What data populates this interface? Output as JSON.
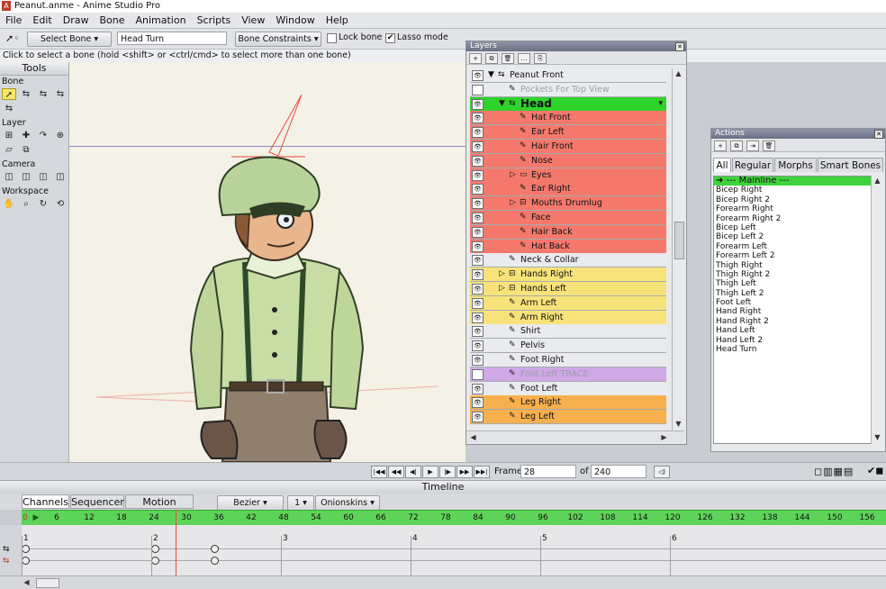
{
  "window": {
    "title": "Peanut.anme - Anime Studio Pro",
    "app_icon": "A"
  },
  "menu": [
    "File",
    "Edit",
    "Draw",
    "Bone",
    "Animation",
    "Scripts",
    "View",
    "Window",
    "Help"
  ],
  "toolbar": {
    "mode_select": "Select Bone",
    "bone_name": "Head Turn",
    "constraints_button": "Bone Constraints",
    "lock_bone_label": "Lock bone",
    "lock_bone_checked": false,
    "lasso_label": "Lasso mode",
    "lasso_checked": true
  },
  "hint": "Click to select a bone (hold <shift> or <ctrl/cmd> to select more than one bone)",
  "tools": {
    "title": "Tools",
    "sections": [
      "Bone",
      "Layer",
      "Camera",
      "Workspace"
    ]
  },
  "layers": {
    "title": "Layers",
    "rows": [
      {
        "name": "Peanut Front",
        "color": "#e9ebee",
        "indent": 0,
        "arrow": "▼",
        "kind": "bone",
        "hidden": false
      },
      {
        "name": "Pockets For Top View",
        "color": "#e9ebee",
        "indent": 1,
        "arrow": "",
        "kind": "vector",
        "hidden": true
      },
      {
        "name": "Head",
        "color": "#2fd32b",
        "indent": 1,
        "arrow": "▼",
        "kind": "bone",
        "hidden": false,
        "selected": true
      },
      {
        "name": "Hat Front",
        "color": "#f4796c",
        "indent": 2,
        "arrow": "",
        "kind": "vector",
        "hidden": false
      },
      {
        "name": "Ear Left",
        "color": "#f4796c",
        "indent": 2,
        "arrow": "",
        "kind": "vector",
        "hidden": false
      },
      {
        "name": "Hair Front",
        "color": "#f4796c",
        "indent": 2,
        "arrow": "",
        "kind": "vector",
        "hidden": false
      },
      {
        "name": "Nose",
        "color": "#f4796c",
        "indent": 2,
        "arrow": "",
        "kind": "vector",
        "hidden": false
      },
      {
        "name": "Eyes",
        "color": "#f4796c",
        "indent": 2,
        "arrow": "▷",
        "kind": "group",
        "hidden": false
      },
      {
        "name": "Ear Right",
        "color": "#f4796c",
        "indent": 2,
        "arrow": "",
        "kind": "vector",
        "hidden": false
      },
      {
        "name": "Mouths Drumlug",
        "color": "#f4796c",
        "indent": 2,
        "arrow": "▷",
        "kind": "switch",
        "hidden": false
      },
      {
        "name": "Face",
        "color": "#f4796c",
        "indent": 2,
        "arrow": "",
        "kind": "vector",
        "hidden": false
      },
      {
        "name": "Hair Back",
        "color": "#f4796c",
        "indent": 2,
        "arrow": "",
        "kind": "vector",
        "hidden": false
      },
      {
        "name": "Hat Back",
        "color": "#f4796c",
        "indent": 2,
        "arrow": "",
        "kind": "vector",
        "hidden": false
      },
      {
        "name": "Neck & Collar",
        "color": "#e9ebee",
        "indent": 1,
        "arrow": "",
        "kind": "vector",
        "hidden": false
      },
      {
        "name": "Hands Right",
        "color": "#f7e37a",
        "indent": 1,
        "arrow": "▷",
        "kind": "switch",
        "hidden": false
      },
      {
        "name": "Hands Left",
        "color": "#f7e37a",
        "indent": 1,
        "arrow": "▷",
        "kind": "switch",
        "hidden": false
      },
      {
        "name": "Arm Left",
        "color": "#f7e37a",
        "indent": 1,
        "arrow": "",
        "kind": "vector",
        "hidden": false
      },
      {
        "name": "Arm Right",
        "color": "#f7e37a",
        "indent": 1,
        "arrow": "",
        "kind": "vector",
        "hidden": false
      },
      {
        "name": "Shirt",
        "color": "#e9ebee",
        "indent": 1,
        "arrow": "",
        "kind": "vector",
        "hidden": false
      },
      {
        "name": "Pelvis",
        "color": "#e9ebee",
        "indent": 1,
        "arrow": "",
        "kind": "vector",
        "hidden": false
      },
      {
        "name": "Foot Right",
        "color": "#e9ebee",
        "indent": 1,
        "arrow": "",
        "kind": "vector",
        "hidden": false
      },
      {
        "name": "Foot Left TRACE",
        "color": "#cfa8e6",
        "indent": 1,
        "arrow": "",
        "kind": "vector",
        "hidden": true
      },
      {
        "name": "Foot Left",
        "color": "#e9ebee",
        "indent": 1,
        "arrow": "",
        "kind": "vector",
        "hidden": false
      },
      {
        "name": "Leg Right",
        "color": "#f7b04e",
        "indent": 1,
        "arrow": "",
        "kind": "vector",
        "hidden": false
      },
      {
        "name": "Leg Left",
        "color": "#f7b04e",
        "indent": 1,
        "arrow": "",
        "kind": "vector",
        "hidden": false
      }
    ]
  },
  "actions": {
    "title": "Actions",
    "tabs": [
      "All",
      "Regular",
      "Morphs",
      "Smart Bones"
    ],
    "mainline": "--- Mainline ---",
    "items": [
      "Bicep Right",
      "Bicep Right 2",
      "Forearm Right",
      "Forearm Right 2",
      "Bicep Left",
      "Bicep Left 2",
      "Forearm Left",
      "Forearm Left 2",
      "Thigh Right",
      "Thigh Right 2",
      "Thigh Left",
      "Thigh Left 2",
      "Foot Left",
      "Hand Right",
      "Hand Right 2",
      "Hand Left",
      "Hand Left 2",
      "Head Turn"
    ]
  },
  "playback": {
    "frame_label": "Frame",
    "frame_value": "28",
    "of_label": "of",
    "total_frames": "240"
  },
  "timeline": {
    "title": "Timeline",
    "tabs": [
      "Channels",
      "Sequencer",
      "Motion Graph"
    ],
    "interp": "Bezier",
    "interp_count": "1",
    "onionskins": "Onionskins",
    "ruler_start": "0",
    "ruler_labels": [
      "6",
      "12",
      "18",
      "24",
      "30",
      "36",
      "42",
      "48",
      "54",
      "60",
      "66",
      "72",
      "78",
      "84",
      "90",
      "96",
      "102",
      "108",
      "114",
      "120",
      "126",
      "132",
      "138",
      "144",
      "150",
      "156"
    ],
    "sections": [
      "1",
      "2",
      "3",
      "4",
      "5",
      "6"
    ]
  },
  "colors": {
    "accent_green": "#2fd32b",
    "red_layer": "#f4796c",
    "yellow_layer": "#f7e37a",
    "orange_layer": "#f7b04e",
    "purple_layer": "#cfa8e6"
  }
}
